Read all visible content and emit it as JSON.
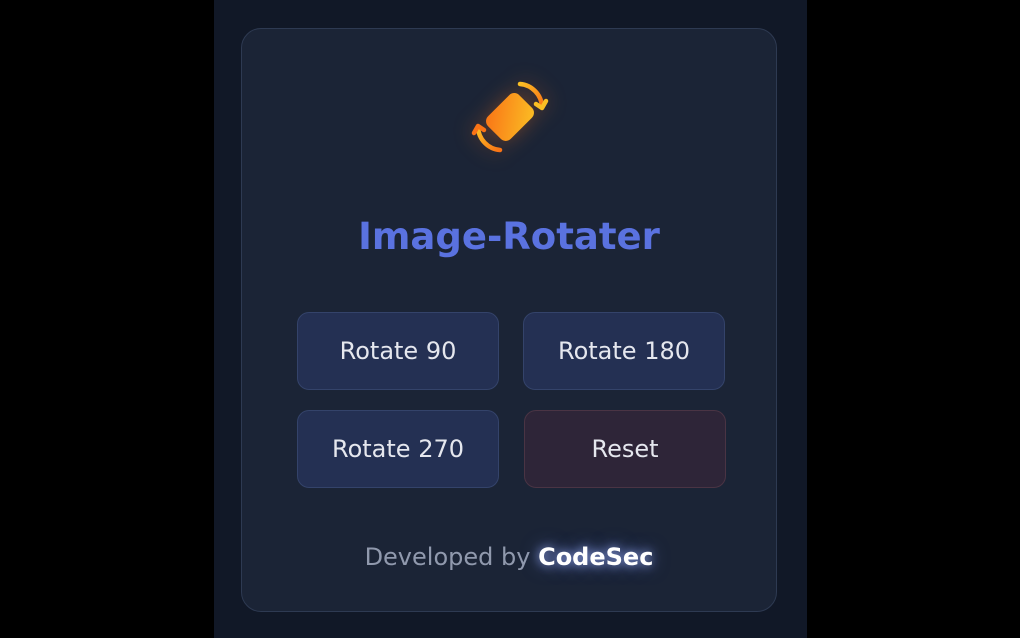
{
  "app": {
    "icon": "rotate-image-icon",
    "title": "Image-Rotater"
  },
  "buttons": {
    "rotate90": "Rotate 90",
    "rotate180": "Rotate 180",
    "rotate270": "Rotate 270",
    "reset": "Reset"
  },
  "footer": {
    "prefix": "Developed by",
    "brand": "CodeSec"
  },
  "colors": {
    "page_bg": "#111827",
    "card_bg": "#1b2436",
    "title": "#5a72e0",
    "button_bg": "#243053",
    "reset_bg": "#2e2538",
    "icon_orange": "#f97316",
    "icon_amber": "#fbbf24"
  }
}
